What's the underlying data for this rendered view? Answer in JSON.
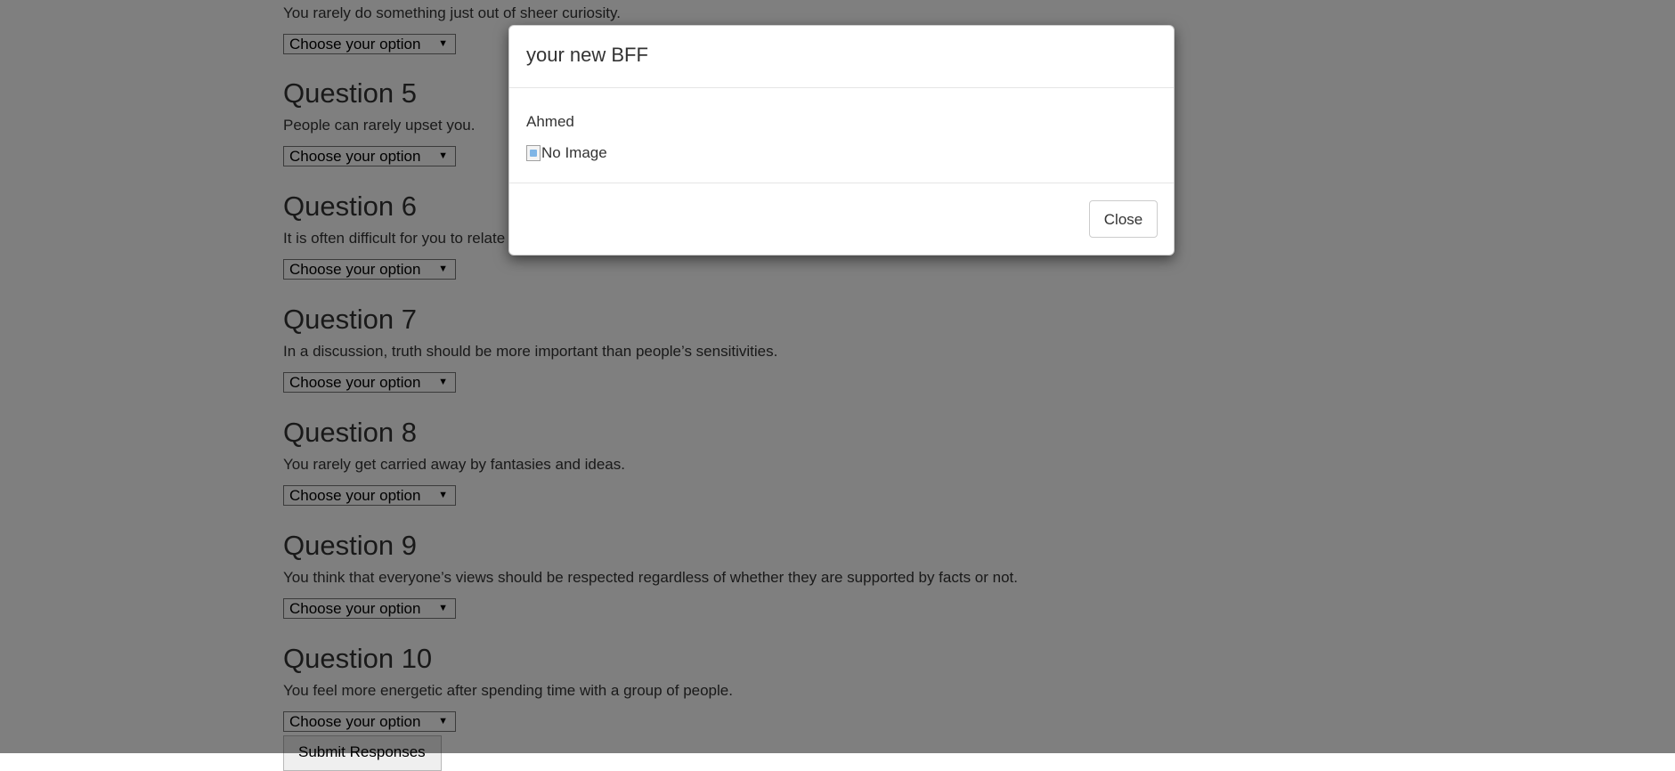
{
  "survey": {
    "select_placeholder": "Choose your option",
    "select_arrow": "▼",
    "questions": [
      {
        "text": "You rarely do something just out of sheer curiosity."
      },
      {
        "title": "Question 5",
        "text": "People can rarely upset you."
      },
      {
        "title": "Question 6",
        "text": "It is often difficult for you to relate"
      },
      {
        "title": "Question 7",
        "text": "In a discussion, truth should be more important than people’s sensitivities."
      },
      {
        "title": "Question 8",
        "text": "You rarely get carried away by fantasies and ideas."
      },
      {
        "title": "Question 9",
        "text": "You think that everyone’s views should be respected regardless of whether they are supported by facts or not."
      },
      {
        "title": "Question 10",
        "text": "You feel more energetic after spending time with a group of people."
      }
    ],
    "submit_label": "Submit Responses"
  },
  "modal": {
    "title": "your new BFF",
    "friend_name": "Ahmed",
    "image_alt": "No Image",
    "close_label": "Close"
  }
}
